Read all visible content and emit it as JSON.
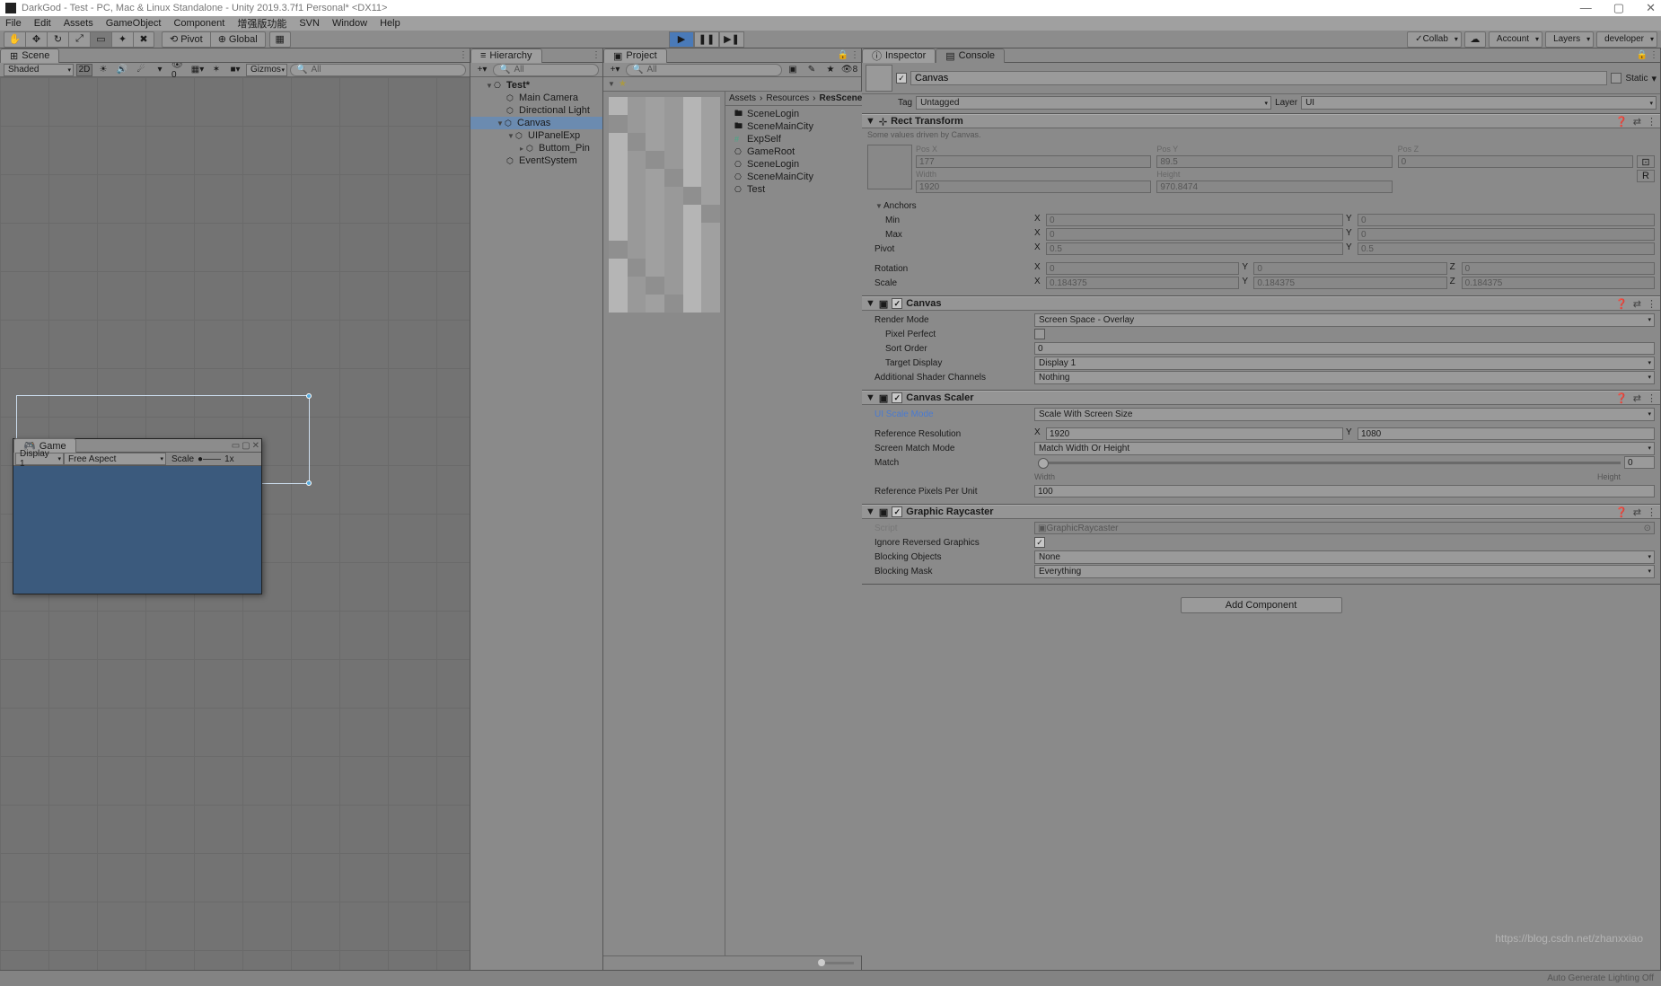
{
  "window": {
    "title": "DarkGod - Test - PC, Mac & Linux Standalone - Unity 2019.3.7f1 Personal* <DX11>"
  },
  "menu": [
    "File",
    "Edit",
    "Assets",
    "GameObject",
    "Component",
    "增强版功能",
    "SVN",
    "Window",
    "Help"
  ],
  "toolbar": {
    "pivot": "Pivot",
    "global": "Global",
    "collab": "Collab",
    "account": "Account",
    "layers": "Layers",
    "layout": "developer"
  },
  "scene": {
    "tab": "Scene",
    "shading": "Shaded",
    "2d": "2D",
    "gizmos": "Gizmos",
    "searchPlaceholder": "All"
  },
  "game": {
    "tab": "Game",
    "display": "Display 1",
    "aspect": "Free Aspect",
    "scaleLabel": "Scale",
    "scaleVal": "1x"
  },
  "hierarchy": {
    "tab": "Hierarchy",
    "searchPlaceholder": "All",
    "scene": "Test*",
    "items": [
      {
        "name": "Main Camera",
        "depth": 1
      },
      {
        "name": "Directional Light",
        "depth": 1
      },
      {
        "name": "Canvas",
        "depth": 1,
        "open": true,
        "sel": true
      },
      {
        "name": "UIPanelExp",
        "depth": 2,
        "open": true
      },
      {
        "name": "Buttom_Pin",
        "depth": 3,
        "arrow": true
      },
      {
        "name": "EventSystem",
        "depth": 1
      }
    ]
  },
  "project": {
    "tab": "Project",
    "searchPlaceholder": "All",
    "starCount": "8",
    "breadcrumb": [
      "Assets",
      "Resources",
      "ResScene"
    ],
    "folders": [
      "SceneLogin",
      "SceneMainCity",
      "ExpSelf",
      "GameRoot",
      "SceneLogin",
      "SceneMainCity",
      "Test"
    ]
  },
  "inspector": {
    "tabs": [
      "Inspector",
      "Console"
    ],
    "name": "Canvas",
    "static": "Static",
    "tagLabel": "Tag",
    "tag": "Untagged",
    "layerLabel": "Layer",
    "layer": "UI",
    "rect": {
      "title": "Rect Transform",
      "note": "Some values driven by Canvas.",
      "posx_l": "Pos X",
      "posx": "177",
      "posy_l": "Pos Y",
      "posy": "89.5",
      "posz_l": "Pos Z",
      "posz": "0",
      "w_l": "Width",
      "w": "1920",
      "h_l": "Height",
      "h": "970.8474",
      "anchors": "Anchors",
      "min": "Min",
      "max": "Max",
      "minx": "0",
      "miny": "0",
      "maxx": "0",
      "maxy": "0",
      "pivot": "Pivot",
      "pivx": "0.5",
      "pivy": "0.5",
      "rotation": "Rotation",
      "rx": "0",
      "ry": "0",
      "rz": "0",
      "scale": "Scale",
      "sx": "0.184375",
      "sy": "0.184375",
      "sz": "0.184375"
    },
    "canvas": {
      "title": "Canvas",
      "renderModeL": "Render Mode",
      "renderMode": "Screen Space - Overlay",
      "pixelPerfect": "Pixel Perfect",
      "sortOrderL": "Sort Order",
      "sortOrder": "0",
      "targetDisplayL": "Target Display",
      "targetDisplay": "Display 1",
      "shaderChL": "Additional Shader Channels",
      "shaderCh": "Nothing"
    },
    "scaler": {
      "title": "Canvas Scaler",
      "modeL": "UI Scale Mode",
      "mode": "Scale With Screen Size",
      "refResL": "Reference Resolution",
      "refX": "1920",
      "refY": "1080",
      "matchModeL": "Screen Match Mode",
      "matchMode": "Match Width Or Height",
      "matchL": "Match",
      "matchVal": "0",
      "widthL": "Width",
      "heightL": "Height",
      "refPxL": "Reference Pixels Per Unit",
      "refPx": "100"
    },
    "raycaster": {
      "title": "Graphic Raycaster",
      "scriptL": "Script",
      "script": "GraphicRaycaster",
      "ignoreL": "Ignore Reversed Graphics",
      "blockObjL": "Blocking Objects",
      "blockObj": "None",
      "blockMaskL": "Blocking Mask",
      "blockMask": "Everything"
    },
    "addComponent": "Add Component"
  },
  "status": {
    "lighting": "Auto Generate Lighting Off"
  },
  "watermark": "https://blog.csdn.net/zhanxxiao"
}
